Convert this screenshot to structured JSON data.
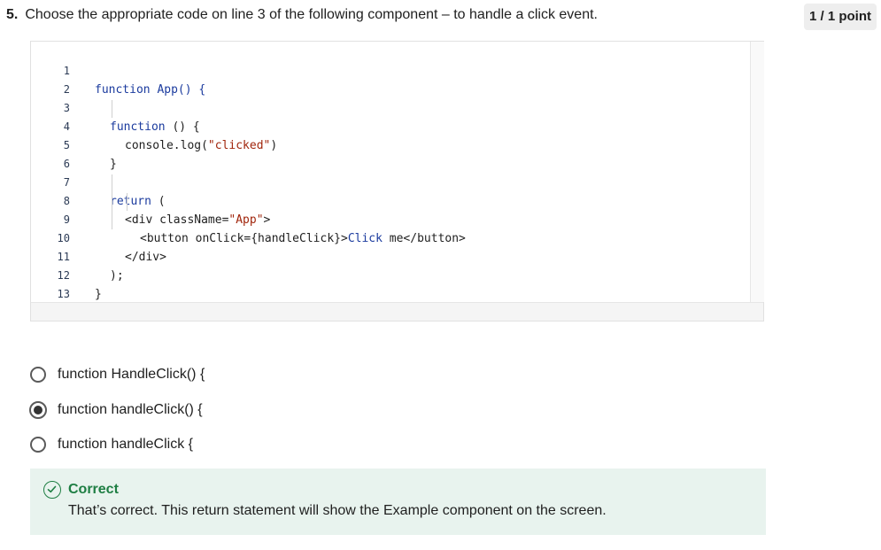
{
  "question": {
    "number": "5.",
    "text": "Choose the appropriate code on line 3 of the following component – to handle a click event.",
    "points": "1 / 1 point"
  },
  "code": {
    "line_numbers": [
      "1",
      "2",
      "3",
      "4",
      "5",
      "6",
      "7",
      "8",
      "9",
      "10",
      "11",
      "12",
      "13"
    ],
    "lines": {
      "l1_kw": "function",
      "l1_rest": " App() {",
      "l3_kw": "function",
      "l3_rest": " () {",
      "l4_pre": "console.log(",
      "l4_str": "\"clicked\"",
      "l4_post": ")",
      "l5": "}",
      "l7_kw": "return",
      "l7_rest": " (",
      "l8_pre": "<div className=",
      "l8_str": "\"App\"",
      "l8_post": ">",
      "l9_pre": "<button onClick={handleClick}>",
      "l9_text": "Click",
      "l9_post": " me</button>",
      "l10": "</div>",
      "l11": ");",
      "l12": "}"
    }
  },
  "options": [
    {
      "label": "function HandleClick() {",
      "selected": false
    },
    {
      "label": "function handleClick() {",
      "selected": true
    },
    {
      "label": "function handleClick {",
      "selected": false
    }
  ],
  "feedback": {
    "title": "Correct",
    "message": "That’s correct. This return statement will show the Example component on the screen.",
    "icon": "check-circle-icon",
    "color": "#1e7e43",
    "background": "#e8f3ee"
  }
}
